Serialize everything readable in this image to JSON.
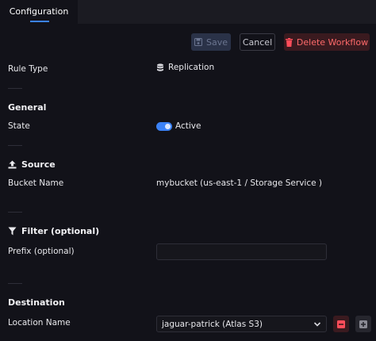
{
  "tabs": [
    {
      "label": "Configuration"
    }
  ],
  "toolbar": {
    "save_label": "Save",
    "cancel_label": "Cancel",
    "delete_label": "Delete Workflow"
  },
  "rule_type": {
    "label": "Rule Type",
    "value": "Replication"
  },
  "general": {
    "heading": "General",
    "state_label": "State",
    "state_value": "Active"
  },
  "source": {
    "heading": "Source",
    "bucket_label": "Bucket Name",
    "bucket_value": "mybucket (us-east-1 / Storage Service )"
  },
  "filter": {
    "heading": "Filter (optional)",
    "prefix_label": "Prefix (optional)",
    "prefix_value": ""
  },
  "destination": {
    "heading": "Destination",
    "location_label": "Location Name",
    "location_value": "jaguar-patrick (Atlas S3)"
  },
  "colors": {
    "accent": "#3b82f6",
    "danger": "#ff6a6a",
    "background": "#121219"
  },
  "icons": [
    "save-icon",
    "trash-icon",
    "database-icon",
    "upload-icon",
    "filter-icon",
    "chevron-down-icon",
    "minus-icon",
    "plus-icon"
  ]
}
